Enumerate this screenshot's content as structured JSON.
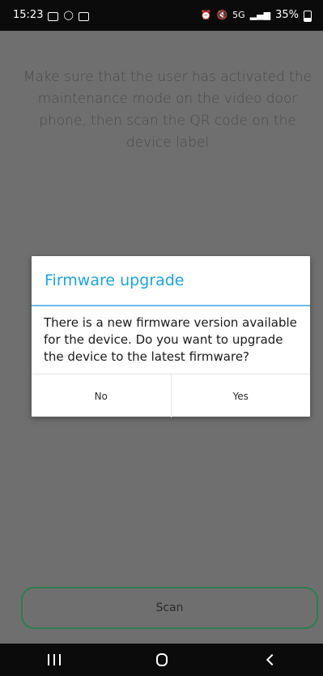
{
  "status_bar": {
    "time": "15:23",
    "battery_percent": "35%",
    "network_badge": "5G"
  },
  "background": {
    "instruction": "Make sure that the user has activated the maintenance mode on the video door phone, then scan the QR code on the device label"
  },
  "dialog": {
    "title": "Firmware upgrade",
    "message": "There is a new firmware version available for the device. Do you want to upgrade the device to the latest firmware?",
    "buttons": {
      "no": "No",
      "yes": "Yes"
    }
  },
  "scan_button": {
    "label": "Scan"
  },
  "nav_bar": {
    "items": [
      "recent-apps",
      "home",
      "back"
    ]
  },
  "colors": {
    "dim_overlay": "#6f6f6f",
    "dialog_title": "#1fa2dd",
    "dialog_divider": "#67bde8",
    "scan_border": "#2e7d4f"
  }
}
